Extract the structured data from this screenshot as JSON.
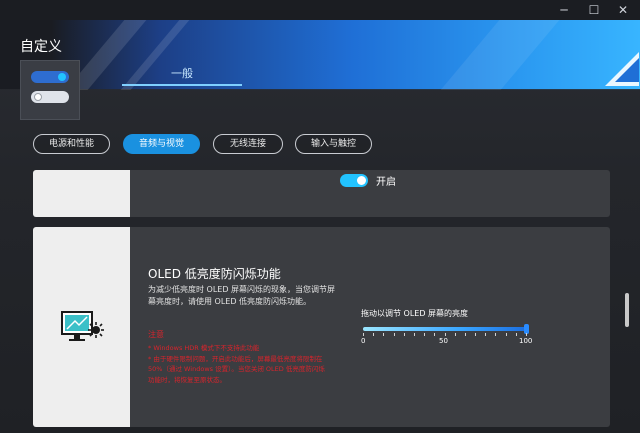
{
  "window": {
    "title": "自定义",
    "minimize_glyph": "─",
    "maximize_glyph": "☐",
    "close_glyph": "✕"
  },
  "main_tabs": [
    {
      "label": "一般",
      "active": true
    }
  ],
  "subnav": [
    {
      "label": "电源和性能",
      "active": false
    },
    {
      "label": "音频与视觉",
      "active": true
    },
    {
      "label": "无线连接",
      "active": false
    },
    {
      "label": "输入与触控",
      "active": false
    }
  ],
  "panel_top": {
    "toggle_label": "开启",
    "toggle_on": true
  },
  "oled_panel": {
    "icon": "monitor-flicker-icon",
    "title": "OLED 低亮度防闪烁功能",
    "description": "为减少低亮度时 OLED 屏幕闪烁的现象，当您调节屏幕亮度时，请使用 OLED 低亮度防闪烁功能。",
    "note_title": "注意",
    "note_body": [
      "* Windows HDR 模式下不支持此功能",
      "* 由于硬件限制问题，开启此功能后，屏幕最低亮度将限制在 50%（通过 Windows 设置）。当您关闭 OLED 低亮度防闪烁功能时，将恢复至原状态。"
    ],
    "slider": {
      "label": "拖动以调节 OLED 屏幕的亮度",
      "value": 100,
      "min": 0,
      "max": 100,
      "tick_labels": [
        "0",
        "50",
        "100"
      ]
    }
  },
  "colors": {
    "accent": "#1a91e0",
    "warning": "#d9242c",
    "toggle": "#22c3ff"
  }
}
